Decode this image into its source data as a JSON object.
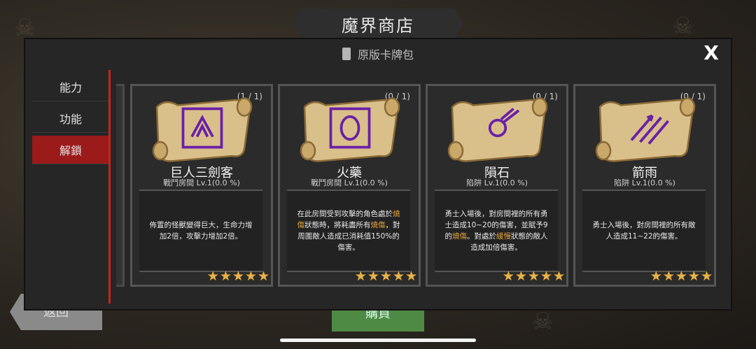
{
  "title": "魔界商店",
  "panel": {
    "header": "原版卡牌包",
    "close_label": "X"
  },
  "tabs": [
    {
      "label": "能力",
      "active": false
    },
    {
      "label": "功能",
      "active": false
    },
    {
      "label": "解鎖",
      "active": true
    }
  ],
  "footer": {
    "back_label": "返回",
    "buy_label": "購買"
  },
  "cards": [
    {
      "count": "(1 / 1)",
      "name": "巨人三劍客",
      "sub": "戰鬥房間 Lv.1(0.0 %)",
      "desc": [
        "佈置的怪獸變得巨大，生命力增加2倍，攻擊力增加2倍。"
      ],
      "stars": 5,
      "icon": "three-swords-icon"
    },
    {
      "count": "(0 / 1)",
      "name": "火藥",
      "sub": "戰鬥房間 Lv.1(0.0 %)",
      "desc": [
        "在此房間受到攻擊的角色處於",
        "燒傷",
        "狀態時，將耗盡所有",
        "燒傷",
        "，對周圍敵人造成已消耗值150%的傷害。"
      ],
      "stars": 5,
      "icon": "powder-keg-icon"
    },
    {
      "count": "(0 / 1)",
      "name": "隕石",
      "sub": "陷阱 Lv.1(0.0 %)",
      "desc": [
        "勇士入場後，對房間裡的所有勇士造成10~20的傷害，並賦予9的",
        "燒傷",
        "。對處於",
        "緩慢",
        "狀態的敵人造成加倍傷害。"
      ],
      "stars": 5,
      "icon": "meteor-icon"
    },
    {
      "count": "(0 / 1)",
      "name": "箭雨",
      "sub": "陷阱 Lv.1(0.0 %)",
      "desc": [
        "勇士入場後，對房間裡的所有敵人造成11~22的傷害。"
      ],
      "stars": 5,
      "icon": "arrow-rain-icon"
    }
  ],
  "colors": {
    "accent": "#c8241b",
    "highlight": "#e0a23a",
    "star": "#e6b24a"
  }
}
